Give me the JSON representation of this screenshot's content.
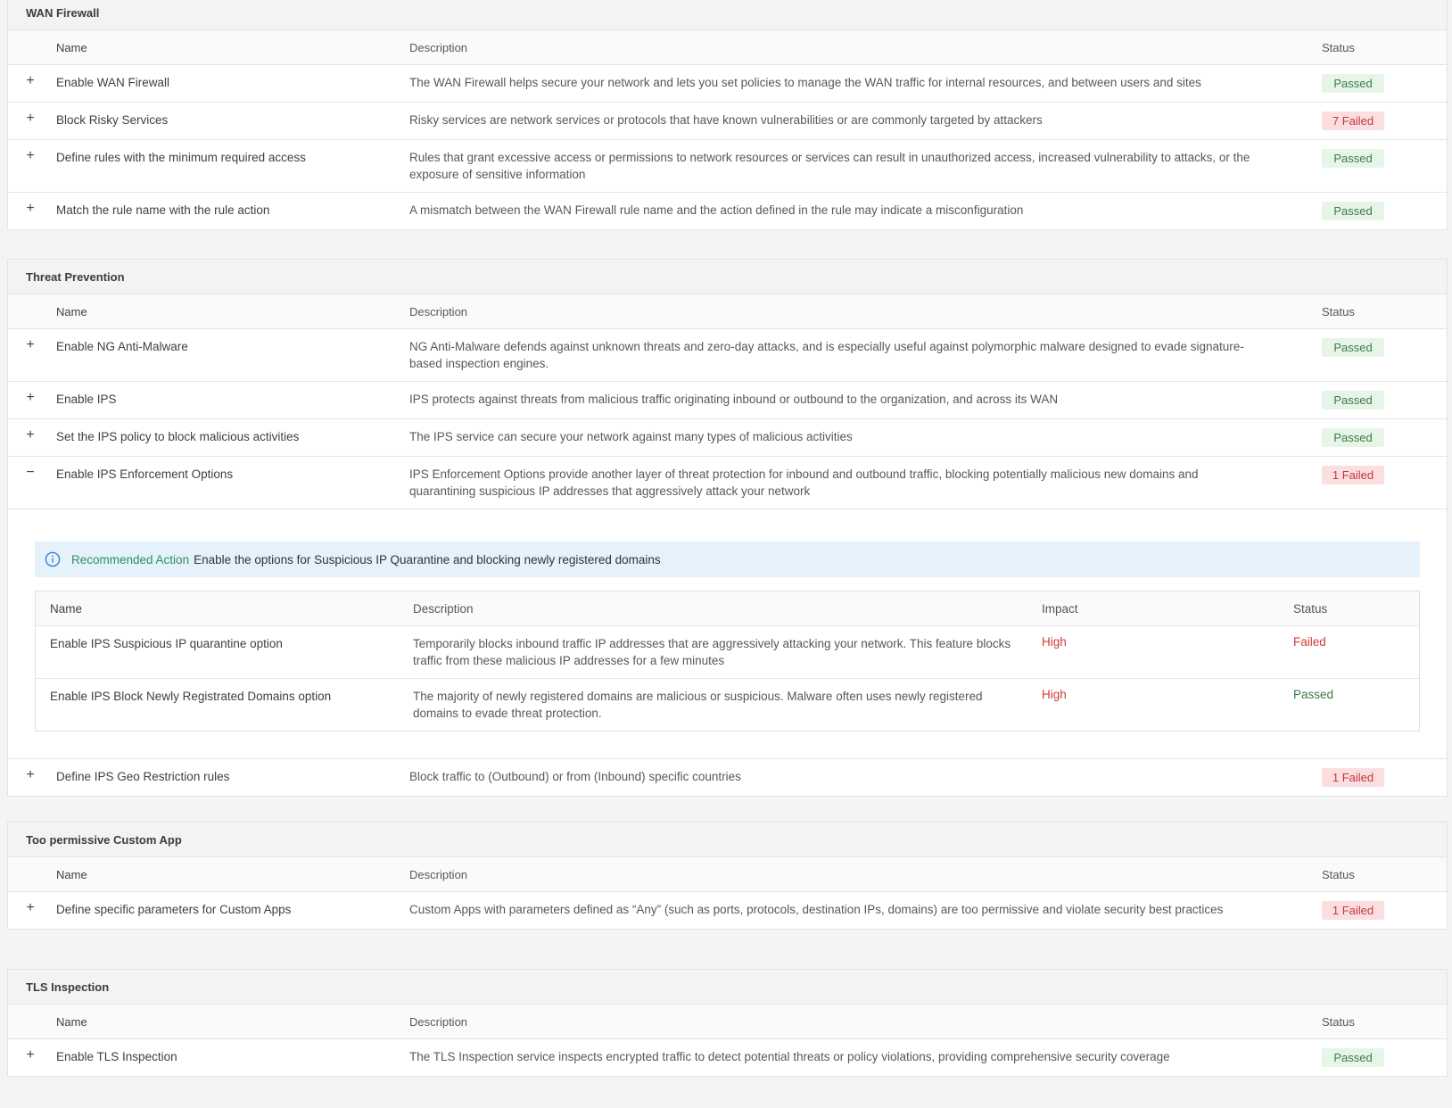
{
  "columns": {
    "name": "Name",
    "description": "Description",
    "status": "Status",
    "impact": "Impact"
  },
  "toggle": {
    "expand": "+",
    "collapse": "−"
  },
  "wan": {
    "title": "WAN Firewall",
    "rows": [
      {
        "name": "Enable WAN Firewall",
        "description": "The WAN Firewall helps secure your network and lets you set policies to manage the WAN traffic for internal resources, and between users and sites",
        "status": "Passed"
      },
      {
        "name": "Block Risky Services",
        "description": "Risky services are network services or protocols that have known vulnerabilities or are commonly targeted by attackers",
        "status": "7 Failed"
      },
      {
        "name": "Define rules with the minimum required access",
        "description": "Rules that grant excessive access or permissions to network resources or services can result in unauthorized access, increased vulnerability to attacks, or the exposure of sensitive information",
        "status": "Passed"
      },
      {
        "name": "Match the rule name with the rule action",
        "description": "A mismatch between the WAN Firewall rule name and the action defined in the rule may indicate a misconfiguration",
        "status": "Passed"
      }
    ]
  },
  "threat": {
    "title": "Threat Prevention",
    "rows": [
      {
        "name": "Enable NG Anti-Malware",
        "description": "NG Anti-Malware defends against unknown threats and zero-day attacks, and is especially useful against polymorphic malware designed to evade signature-based inspection engines.",
        "status": "Passed"
      },
      {
        "name": "Enable IPS",
        "description": "IPS protects against threats from malicious traffic originating inbound or outbound to the organization, and across its WAN",
        "status": "Passed"
      },
      {
        "name": "Set the IPS policy to block malicious activities",
        "description": "The IPS service can secure your network against many types of malicious activities",
        "status": "Passed"
      },
      {
        "name": "Enable IPS Enforcement Options",
        "description": "IPS Enforcement Options provide another layer of threat protection for inbound and outbound traffic, blocking potentially malicious new domains and quarantining suspicious IP addresses that aggressively attack your network",
        "status": "1 Failed"
      },
      {
        "name": "Define IPS Geo Restriction rules",
        "description": "Block traffic to (Outbound) or from (Inbound) specific countries",
        "status": "1 Failed"
      }
    ],
    "expanded": {
      "recommended_label": "Recommended Action",
      "recommended_text": "Enable the options for Suspicious IP Quarantine and blocking newly registered domains",
      "rows": [
        {
          "name": "Enable IPS Suspicious IP quarantine option",
          "description": "Temporarily blocks inbound traffic IP addresses that are aggressively attacking your network. This feature blocks traffic from these malicious IP addresses for a few minutes",
          "impact": "High",
          "status": "Failed"
        },
        {
          "name": "Enable IPS Block Newly Registrated Domains option",
          "description": "The majority of newly registered domains are malicious or suspicious. Malware often uses newly registered domains to evade threat protection.",
          "impact": "High",
          "status": "Passed"
        }
      ]
    }
  },
  "custom": {
    "title": "Too permissive Custom App",
    "rows": [
      {
        "name": "Define specific parameters for Custom Apps",
        "description": "Custom Apps with parameters defined as “Any” (such as ports, protocols, destination IPs, domains) are too permissive and violate security best practices",
        "status": "1 Failed"
      }
    ]
  },
  "tls": {
    "title": "TLS Inspection",
    "rows": [
      {
        "name": "Enable TLS Inspection",
        "description": "The TLS Inspection service inspects encrypted traffic to detect potential threats or policy violations, providing comprehensive security coverage",
        "status": "Passed"
      }
    ]
  },
  "colors": {
    "passed_bg": "#e7f5e8",
    "passed_text": "#3a7a45",
    "failed_bg": "#fbdfe0",
    "failed_text": "#c7353c",
    "info_bg": "#e5f1fb",
    "info_icon": "#2a7fd4"
  }
}
